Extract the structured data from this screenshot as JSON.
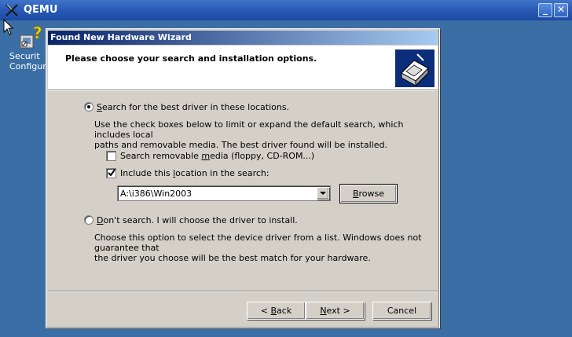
{
  "qemu": {
    "title": "QEMU",
    "icon": "qemu-x-icon",
    "minimize_glyph": "_",
    "close_glyph": "✕"
  },
  "desktop": {
    "icon": "security-configuration-icon",
    "icon_label_line1": "Securit",
    "icon_label_line2": "Configura"
  },
  "wizard": {
    "title": "Found New Hardware Wizard",
    "header": "Please choose your search and installation options.",
    "header_icon": "hardware-wizard-icon",
    "option_search": {
      "label_pre": "",
      "label_key": "S",
      "label_post": "earch for the best driver in these locations.",
      "selected": true,
      "description_line1": "Use the check boxes below to limit or expand the default search, which includes local",
      "description_line2": "paths and removable media. The best driver found will be installed."
    },
    "check_removable": {
      "label_pre": "Search removable ",
      "label_key": "m",
      "label_post": "edia (floppy, CD-ROM...)",
      "checked": false
    },
    "check_location": {
      "label_pre": "Include this ",
      "label_key": "l",
      "label_post": "ocation in the search:",
      "checked": true
    },
    "location_combo_value": "A:\\i386\\Win2003",
    "browse": {
      "label_pre": "",
      "label_key": "B",
      "label_post": "rowse"
    },
    "option_dont_search": {
      "label_pre": "",
      "label_key": "D",
      "label_post": "on't search. I will choose the driver to install.",
      "selected": false,
      "description_line1": "Choose this option to select the device driver from a list.  Windows does not guarantee that",
      "description_line2": "the driver you choose will be the best match for your hardware."
    },
    "buttons": {
      "back": {
        "label_pre": "< ",
        "label_key": "B",
        "label_post": "ack"
      },
      "next": {
        "label_pre": "",
        "label_key": "N",
        "label_post": "ext >"
      },
      "cancel": "Cancel"
    }
  }
}
